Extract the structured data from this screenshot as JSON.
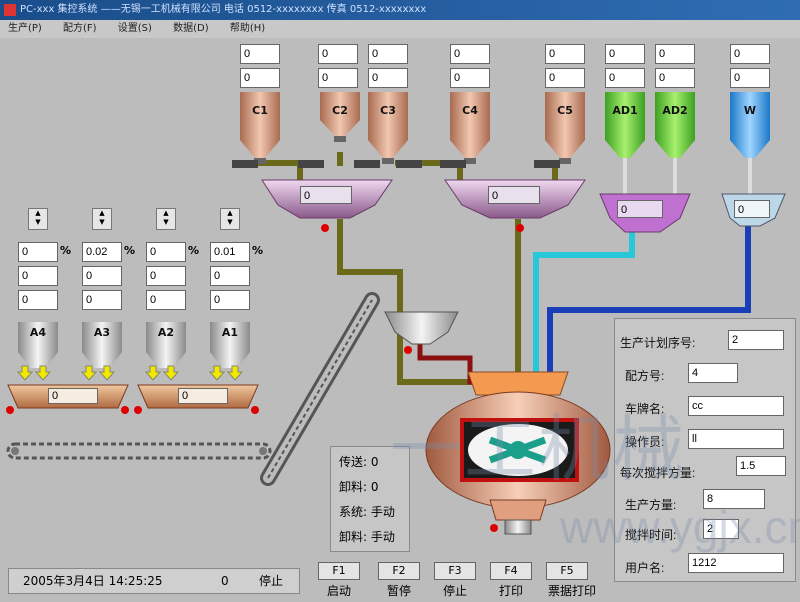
{
  "title": "PC-xxx 集控系统 ——无锡一工机械有限公司   电话 0512-xxxxxxxx   传真 0512-xxxxxxxx",
  "menu": [
    "生产(P)",
    "配方(F)",
    "设置(S)",
    "数据(D)",
    "帮助(H)"
  ],
  "hoppers_top": [
    {
      "label": "C1",
      "v1": "0",
      "v2": "0"
    },
    {
      "label": "C2",
      "v1": "0",
      "v2": "0"
    },
    {
      "label": "C3",
      "v1": "0",
      "v2": "0"
    },
    {
      "label": "C4",
      "v1": "0",
      "v2": "0"
    },
    {
      "label": "C5",
      "v1": "0",
      "v2": "0"
    },
    {
      "label": "AD1",
      "v1": "0",
      "v2": "0"
    },
    {
      "label": "AD2",
      "v1": "0",
      "v2": "0"
    },
    {
      "label": "W",
      "v1": "0",
      "v2": "0"
    }
  ],
  "scales": {
    "cement1": "0",
    "cement2": "0",
    "additive": "0",
    "water": "0",
    "agg1": "0",
    "agg2": "0"
  },
  "aggregates": [
    {
      "label": "A4",
      "pct": "0",
      "v1": "0",
      "v2": "0"
    },
    {
      "label": "A3",
      "pct": "0.02",
      "v1": "0",
      "v2": "0"
    },
    {
      "label": "A2",
      "pct": "0",
      "v1": "0",
      "v2": "0"
    },
    {
      "label": "A1",
      "pct": "0.01",
      "v1": "0",
      "v2": "0"
    }
  ],
  "pct_sign": "%",
  "info": {
    "l1": "传送: 0",
    "l2": "卸料: 0",
    "l3": "系统: 手动",
    "l4": "卸料: 手动"
  },
  "form": {
    "plan_no_label": "生产计划序号:",
    "plan_no": "2",
    "recipe_label": "配方号:",
    "recipe": "4",
    "truck_label": "车牌名:",
    "truck": "cc",
    "operator_label": "操作员:",
    "operator": "ll",
    "batch_label": "每次搅拌方量:",
    "batch": "1.5",
    "volume_label": "生产方量:",
    "volume": "8",
    "mix_label": "搅拌时间:",
    "mix": "2",
    "user_label": "用户名:",
    "user": "1212"
  },
  "fkeys": [
    {
      "key": "F1",
      "cap": "启动"
    },
    {
      "key": "F2",
      "cap": "暂停"
    },
    {
      "key": "F3",
      "cap": "停止"
    },
    {
      "key": "F4",
      "cap": "打印"
    },
    {
      "key": "F5",
      "cap": "票据打印"
    }
  ],
  "status": {
    "datetime": "2005年3月4日 14:25:25",
    "count": "0",
    "state": "停止"
  },
  "watermark": {
    "logo": "一工机械",
    "url": "www.ygjx.cn"
  },
  "colors": {
    "pipe_olive": "#6b6a1a",
    "pipe_cyan": "#29c8d8",
    "pipe_blue": "#1a3db8",
    "pipe_red": "#8b1010"
  }
}
